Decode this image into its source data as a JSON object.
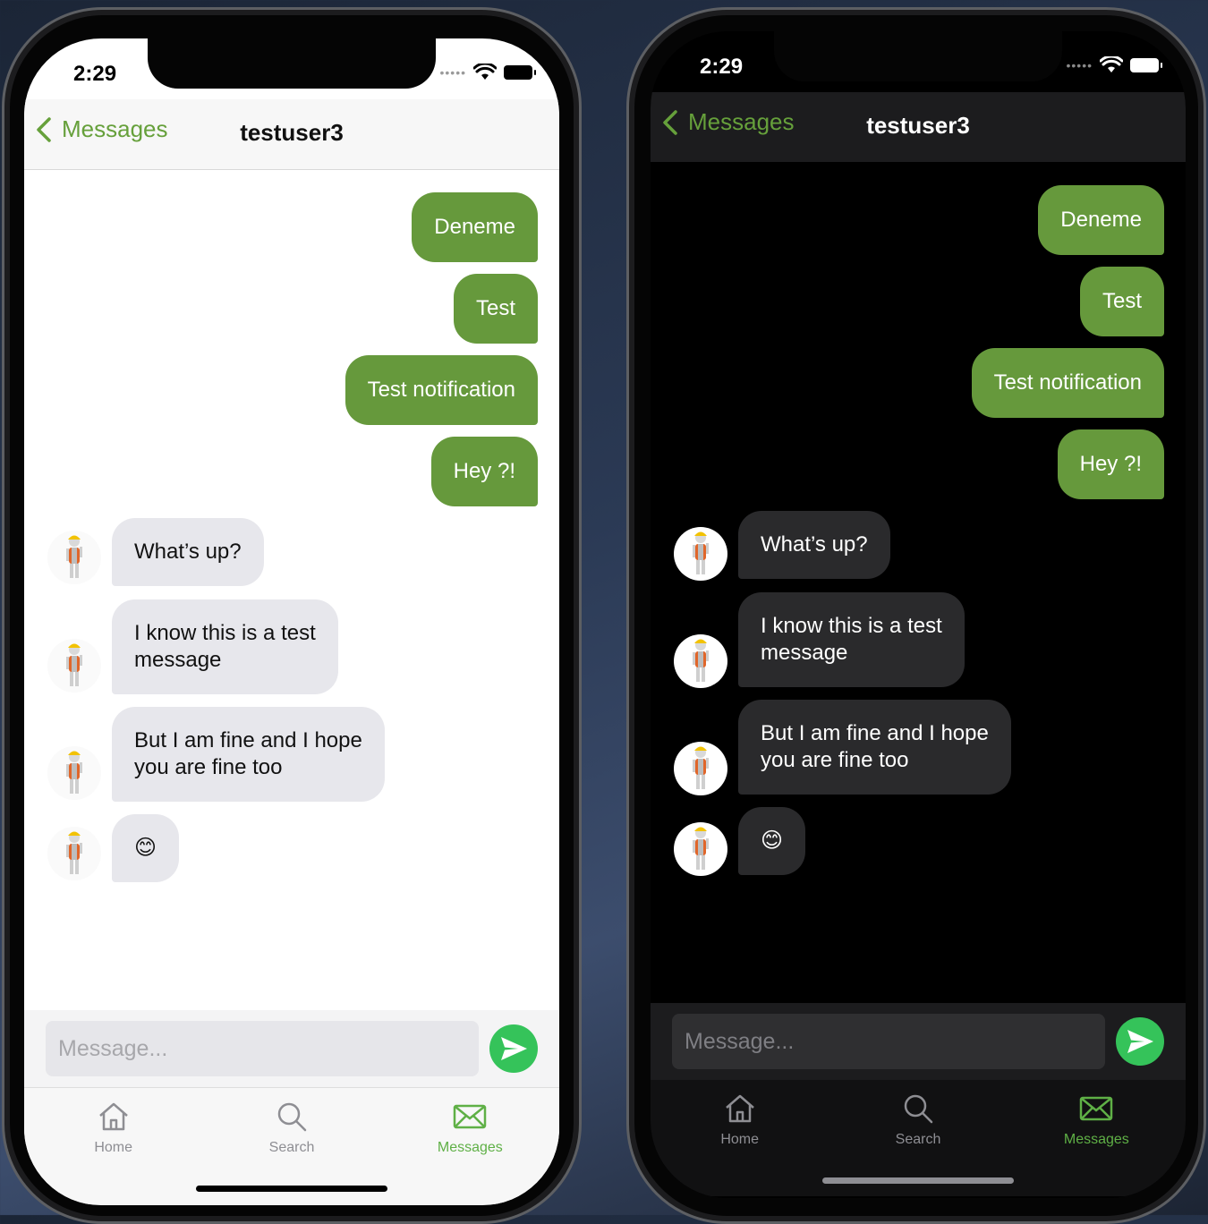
{
  "status": {
    "time": "2:29"
  },
  "nav": {
    "back_label": "Messages",
    "title": "testuser3"
  },
  "messages": {
    "outgoing": [
      "Deneme",
      "Test",
      "Test notification",
      "Hey ?!"
    ],
    "incoming": [
      {
        "line1": "What’s up?",
        "line2": ""
      },
      {
        "line1": "I know this is a test",
        "line2": "message"
      },
      {
        "line1": "But I am fine and I hope",
        "line2": "you are fine too"
      },
      {
        "line1": "😊",
        "line2": ""
      }
    ]
  },
  "composer": {
    "placeholder": "Message..."
  },
  "tabs": [
    {
      "label": "Home",
      "icon": "house-icon",
      "active": false
    },
    {
      "label": "Search",
      "icon": "magnifier-icon",
      "active": false
    },
    {
      "label": "Messages",
      "icon": "envelope-icon",
      "active": true
    }
  ],
  "colors": {
    "accent": "#66993c",
    "send": "#35c35a",
    "tab_active": "#5fb046"
  }
}
